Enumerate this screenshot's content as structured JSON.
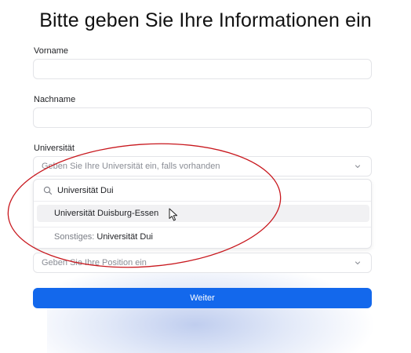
{
  "page": {
    "title": "Bitte geben Sie Ihre Informationen ein"
  },
  "fields": {
    "first_name": {
      "label": "Vorname",
      "value": ""
    },
    "last_name": {
      "label": "Nachname",
      "value": ""
    },
    "university": {
      "label": "Universität",
      "placeholder": "Geben Sie Ihre Universität ein, falls vorhanden",
      "dropdown": {
        "search_value": "Universität Dui",
        "options": [
          {
            "label": "Universität Duisburg-Essen",
            "highlighted": true
          },
          {
            "prefix": "Sonstiges:",
            "label": "Universität Dui"
          }
        ]
      }
    },
    "position": {
      "placeholder": "Geben Sie Ihre Position ein"
    }
  },
  "actions": {
    "submit_label": "Weiter"
  },
  "colors": {
    "primary": "#1368ec",
    "annotation": "#c8171d",
    "border": "#e3e4e8"
  },
  "icons": [
    "chevron-down-icon",
    "search-icon",
    "mouse-cursor-icon"
  ]
}
